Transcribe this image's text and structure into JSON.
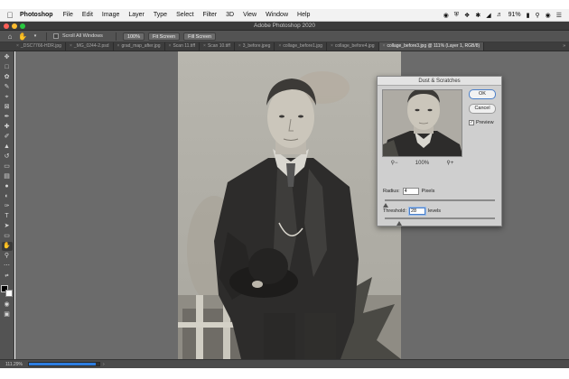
{
  "menubar": {
    "app_name": "Photoshop",
    "items": [
      "File",
      "Edit",
      "Image",
      "Layer",
      "Type",
      "Select",
      "Filter",
      "3D",
      "View",
      "Window",
      "Help"
    ],
    "battery": "91%",
    "status_icons": [
      "creative-cloud-icon",
      "shield-icon",
      "dropbox-icon",
      "bluetooth-icon",
      "wifi-icon",
      "volume-icon",
      "battery-icon",
      "search-icon",
      "control-center-icon",
      "menu-icon"
    ]
  },
  "titlebar": {
    "title": "Adobe Photoshop 2020"
  },
  "options": {
    "scroll_all_label": "Scroll All Windows",
    "zoom_btn": "100%",
    "fit_btn": "Fit Screen",
    "fill_btn": "Fill Screen"
  },
  "tabs": [
    {
      "label": "_DSC7766-HDR.jpg",
      "active": false
    },
    {
      "label": "_MG_0244-2.psd",
      "active": false
    },
    {
      "label": "grad_map_after.jpg",
      "active": false
    },
    {
      "label": "Scan 11.tiff",
      "active": false
    },
    {
      "label": "Scan 10.tiff",
      "active": false
    },
    {
      "label": "3_before.jpeg",
      "active": false
    },
    {
      "label": "collage_before1.jpg",
      "active": false
    },
    {
      "label": "collage_before4.jpg",
      "active": false
    },
    {
      "label": "collage_before3.jpg @ 111% (Layer 1, RGB/8)",
      "active": true
    }
  ],
  "tabs_more": "»",
  "tools": [
    "move-icon",
    "marquee-icon",
    "lasso-icon",
    "quick-select-icon",
    "crop-icon",
    "frame-icon",
    "eyedropper-icon",
    "healing-icon",
    "brush-icon",
    "stamp-icon",
    "history-brush-icon",
    "eraser-icon",
    "gradient-icon",
    "blur-icon",
    "dodge-icon",
    "pen-icon",
    "type-icon",
    "path-select-icon",
    "shape-icon",
    "hand-icon",
    "zoom-icon",
    "more-tools-icon"
  ],
  "active_tool": "hand-icon",
  "dialog": {
    "title": "Dust & Scratches",
    "ok_label": "OK",
    "cancel_label": "Cancel",
    "preview_label": "Preview",
    "preview_checked": true,
    "zoom_level": "100%",
    "radius_label": "Radius:",
    "radius_value": "4",
    "radius_unit": "Pixels",
    "threshold_label": "Threshold:",
    "threshold_value": "28",
    "threshold_unit": "levels"
  },
  "statusbar": {
    "zoom": "111.29%",
    "progress": 0.95
  },
  "colors": {
    "accent": "#2d7de0",
    "workspace": "#6b6b6b",
    "panel": "#535353"
  }
}
